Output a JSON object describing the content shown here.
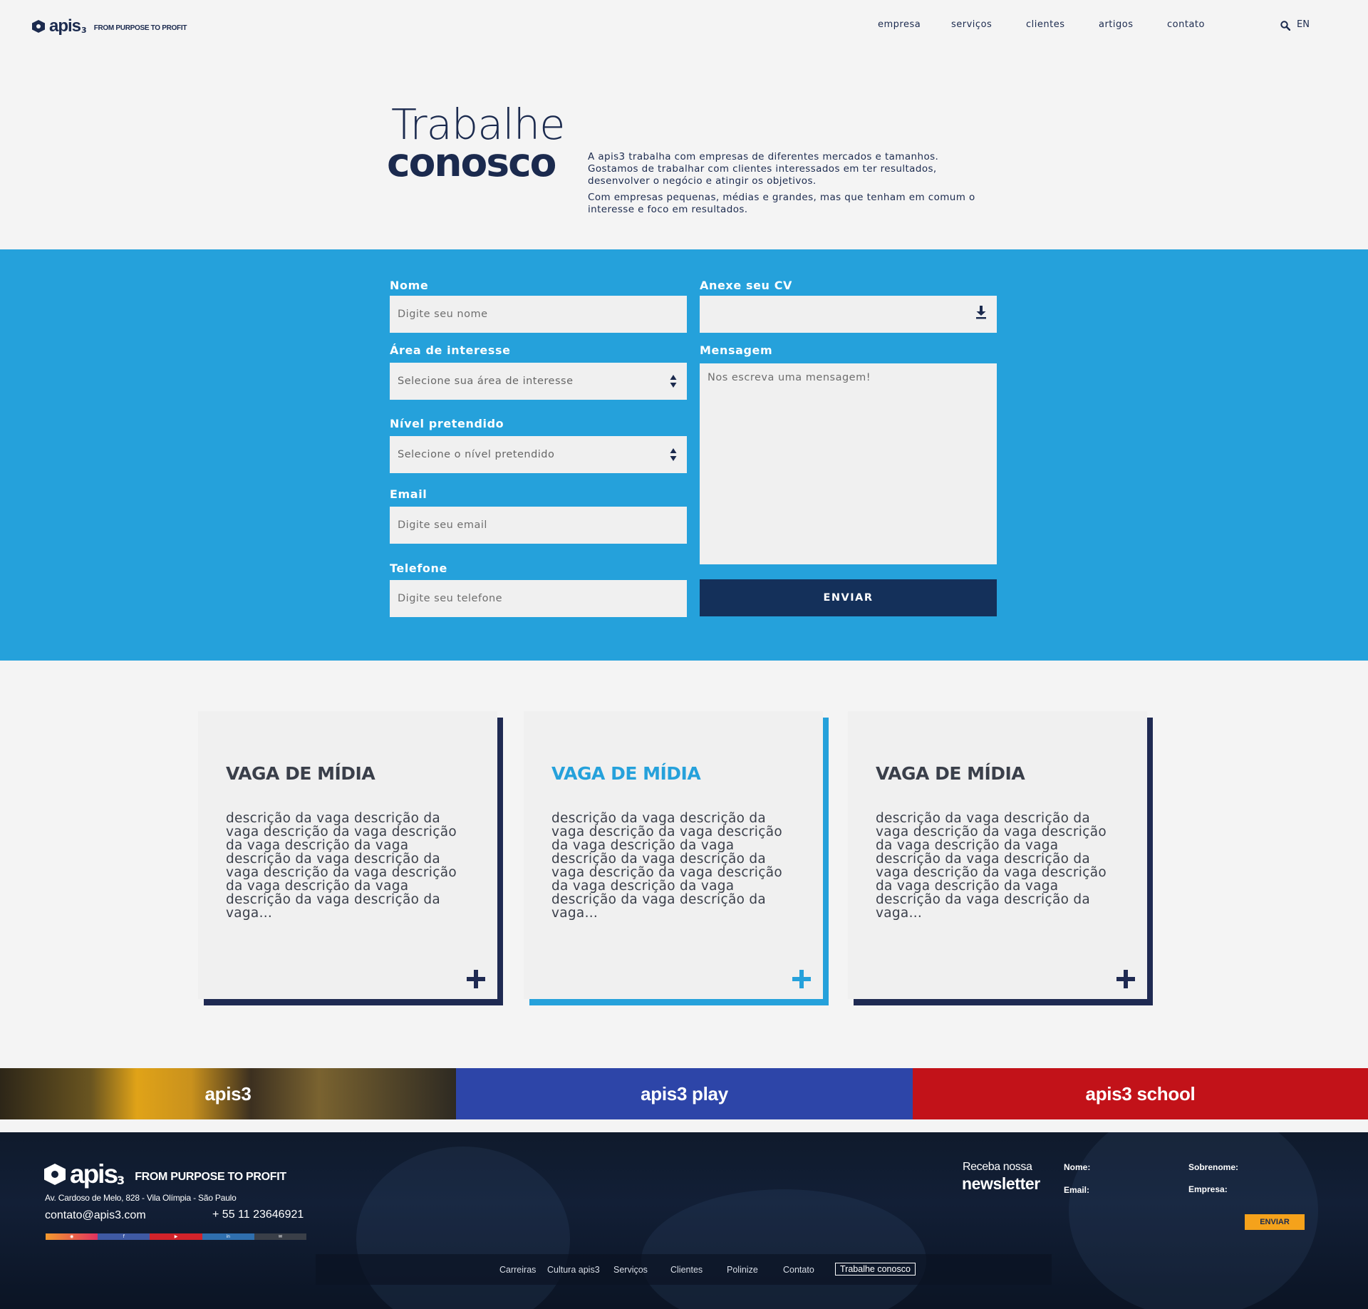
{
  "header": {
    "brand": "apis",
    "brand_suffix": "3",
    "tagline": "FROM PURPOSE TO PROFIT",
    "nav": [
      "empresa",
      "serviços",
      "clientes",
      "artigos",
      "contato"
    ],
    "lang": "EN"
  },
  "hero": {
    "title_light": "Trabalhe",
    "title_bold": "conosco",
    "paragraph_1": "A apis3 trabalha com empresas de diferentes mercados e tamanhos. Gostamos de trabalhar com clientes interessados em ter resultados, desenvolver o negócio e atingir os objetivos.",
    "paragraph_2": "Com empresas pequenas, médias e grandes, mas que tenham em comum o interesse e foco em resultados."
  },
  "form": {
    "nome_label": "Nome",
    "nome_placeholder": "Digite seu nome",
    "area_label": "Área de interesse",
    "area_value": "Selecione sua área de interesse",
    "nivel_label": "Nível pretendido",
    "nivel_value": "Selecione o nível pretendido",
    "email_label": "Email",
    "email_placeholder": "Digite seu email",
    "telefone_label": "Telefone",
    "telefone_placeholder": "Digite seu telefone",
    "cv_label": "Anexe seu CV",
    "mensagem_label": "Mensagem",
    "mensagem_placeholder": "Nos escreva uma mensagem!",
    "submit_label": "ENVIAR"
  },
  "jobs": [
    {
      "title": "VAGA DE MÍDIA",
      "description": "descrição da vaga descrição da vaga descrição da vaga descrição da vaga descrição da vaga descrição da vaga descrição da vaga descrição da vaga descrição da vaga descrição da vaga descrição da vaga descrição da vaga..."
    },
    {
      "title": "VAGA DE MÍDIA",
      "description": "descrição da vaga descrição da vaga descrição da vaga descrição da vaga descrição da vaga descrição da vaga descrição da vaga descrição da vaga descrição da vaga descrição da vaga descrição da vaga descrição da vaga..."
    },
    {
      "title": "VAGA DE MÍDIA",
      "description": "descrição da vaga descrição da vaga descrição da vaga descrição da vaga descrição da vaga descrição da vaga descrição da vaga descrição da vaga descrição da vaga descrição da vaga descrição da vaga descrição da vaga..."
    }
  ],
  "brands": [
    "apis3",
    "apis3 play",
    "apis3 school"
  ],
  "footer": {
    "brand": "apis",
    "brand_suffix": "3",
    "tagline": "FROM PURPOSE TO PROFIT",
    "address": "Av. Cardoso de Melo, 828 - Vila Olímpia - São Paulo",
    "email": "contato@apis3.com",
    "phone": "+ 55 11 23646921",
    "newsletter_small": "Receba nossa",
    "newsletter_big": "newsletter",
    "field_nome": "Nome:",
    "field_sobrenome": "Sobrenome:",
    "field_email": "Email:",
    "field_empresa": "Empresa:",
    "newsletter_button": "ENVIAR",
    "links": [
      "Carreiras",
      "Cultura apis3",
      "Serviços",
      "Clientes",
      "Polinize",
      "Contato",
      "Trabalhe conosco"
    ]
  },
  "colors": {
    "navy": "#1b2a4e",
    "blue": "#25a1db",
    "button_navy": "#14305a",
    "play_blue": "#2d45a8",
    "school_red": "#c21219",
    "newsletter_yellow": "#f5a21b"
  },
  "icons": {
    "search": "search-icon",
    "upload": "download-arrow-icon",
    "select": "up-down-arrows-icon",
    "plus": "plus-icon",
    "social": [
      "instagram-icon",
      "facebook-icon",
      "youtube-icon",
      "linkedin-icon",
      "email-icon"
    ]
  }
}
